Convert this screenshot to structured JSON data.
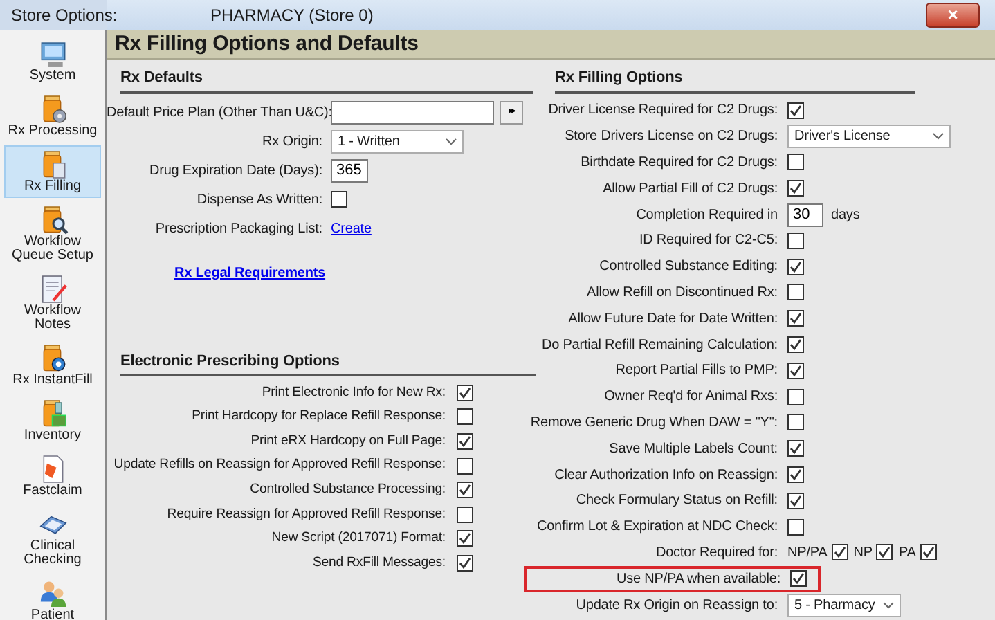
{
  "window": {
    "title": "Store Options:",
    "store": "PHARMACY (Store 0)",
    "close": "×"
  },
  "sidebar": {
    "items": [
      {
        "label": "System",
        "selected": false
      },
      {
        "label": "Rx Processing",
        "selected": false
      },
      {
        "label": "Rx Filling",
        "selected": true
      },
      {
        "label": "Workflow Queue Setup",
        "selected": false
      },
      {
        "label": "Workflow Notes",
        "selected": false
      },
      {
        "label": "Rx InstantFill",
        "selected": false
      },
      {
        "label": "Inventory",
        "selected": false
      },
      {
        "label": "Fastclaim",
        "selected": false
      },
      {
        "label": "Clinical Checking",
        "selected": false
      },
      {
        "label": "Patient",
        "selected": false
      }
    ]
  },
  "page_title": "Rx Filling Options and Defaults",
  "rx_defaults": {
    "title": "Rx Defaults",
    "rows": [
      {
        "kind": "lookup",
        "label": "Default Price Plan (Other Than U&C):",
        "button": "▸▸"
      },
      {
        "kind": "select",
        "label": "Rx Origin:",
        "value": "1 - Written"
      },
      {
        "kind": "text",
        "label": "Drug Expiration Date (Days):",
        "value": "365"
      },
      {
        "kind": "checkbox",
        "label": "Dispense As Written:",
        "checked": false
      },
      {
        "kind": "link",
        "label": "Prescription Packaging List:",
        "value": "Create"
      }
    ],
    "link": "Rx Legal Requirements"
  },
  "e_prescribing": {
    "title": "Electronic Prescribing Options",
    "rows": [
      {
        "label": "Print Electronic Info for New Rx:",
        "checked": true
      },
      {
        "label": "Print Hardcopy for Replace Refill Response:",
        "checked": false
      },
      {
        "label": "Print eRX Hardcopy on Full Page:",
        "checked": true
      },
      {
        "label": "Update Refills on Reassign for Approved Refill Response:",
        "checked": false
      },
      {
        "label": "Controlled Substance Processing:",
        "checked": true
      },
      {
        "label": "Require Reassign for Approved Refill Response:",
        "checked": false
      },
      {
        "label": "New Script (2017071) Format:",
        "checked": true
      },
      {
        "label": "Send RxFill Messages:",
        "checked": true
      }
    ]
  },
  "filling_options": {
    "title": "Rx Filling Options",
    "rows": [
      {
        "kind": "checkbox",
        "label": "Driver License Required for C2 Drugs:",
        "checked": true,
        "highlighted": false
      },
      {
        "kind": "select",
        "label": "Store Drivers License on C2 Drugs:",
        "value": "Driver's License"
      },
      {
        "kind": "checkbox",
        "label": "Birthdate Required for C2 Drugs:",
        "checked": false,
        "highlighted": false
      },
      {
        "kind": "checkbox",
        "label": "Allow Partial Fill of C2 Drugs:",
        "checked": true,
        "highlighted": false
      },
      {
        "kind": "text",
        "label": "Completion Required in",
        "value": "30",
        "suffix": "days"
      },
      {
        "kind": "checkbox",
        "label": "ID Required for C2-C5:",
        "checked": false,
        "highlighted": false
      },
      {
        "kind": "checkbox",
        "label": "Controlled Substance Editing:",
        "checked": true,
        "highlighted": false
      },
      {
        "kind": "checkbox",
        "label": "Allow Refill on Discontinued Rx:",
        "checked": false,
        "highlighted": false
      },
      {
        "kind": "checkbox",
        "label": "Allow Future Date for Date Written:",
        "checked": true,
        "highlighted": false
      },
      {
        "kind": "checkbox",
        "label": "Do Partial Refill Remaining Calculation:",
        "checked": true,
        "highlighted": false
      },
      {
        "kind": "checkbox",
        "label": "Report Partial Fills to PMP:",
        "checked": true,
        "highlighted": false
      },
      {
        "kind": "checkbox",
        "label": "Owner Req'd for Animal Rxs:",
        "checked": false,
        "highlighted": false
      },
      {
        "kind": "checkbox",
        "label": "Remove Generic Drug When DAW = \"Y\":",
        "checked": false,
        "highlighted": false
      },
      {
        "kind": "checkbox",
        "label": "Save Multiple Labels Count:",
        "checked": true,
        "highlighted": false
      },
      {
        "kind": "checkbox",
        "label": "Clear Authorization Info on Reassign:",
        "checked": true,
        "highlighted": false
      },
      {
        "kind": "checkbox",
        "label": "Check Formulary Status on Refill:",
        "checked": true,
        "highlighted": false
      },
      {
        "kind": "checkbox",
        "label": "Confirm Lot & Expiration at NDC Check:",
        "checked": false,
        "highlighted": false
      },
      {
        "kind": "multi",
        "label": "Doctor Required for:",
        "options": [
          {
            "label": "NP/PA",
            "checked": true
          },
          {
            "label": "NP",
            "checked": true
          },
          {
            "label": "PA",
            "checked": true
          }
        ]
      },
      {
        "kind": "checkbox",
        "label": "Use NP/PA when available:",
        "checked": true,
        "highlighted": true
      },
      {
        "kind": "select",
        "label": "Update Rx Origin on Reassign to:",
        "value": "5 - Pharmacy"
      }
    ]
  }
}
